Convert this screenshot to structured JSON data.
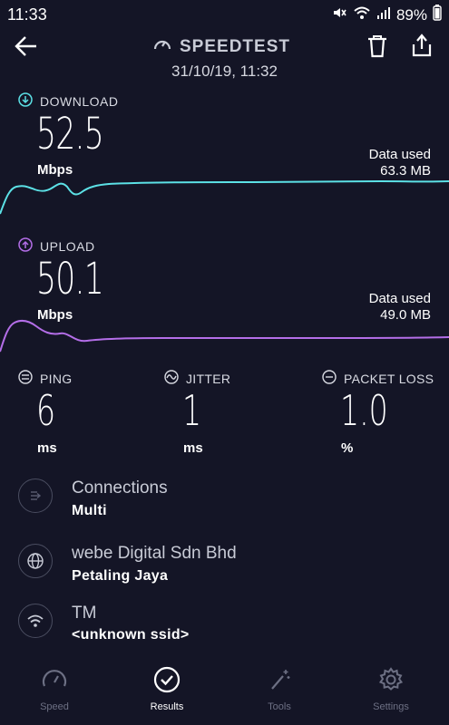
{
  "status_bar": {
    "time": "11:33",
    "battery": "89%"
  },
  "header": {
    "title": "SPEEDTEST",
    "datetime": "31/10/19, 11:32"
  },
  "download": {
    "label": "DOWNLOAD",
    "value": "52.5",
    "unit": "Mbps",
    "data_used_label": "Data used",
    "data_used_value": "63.3 MB",
    "color": "#5ce1e6"
  },
  "upload": {
    "label": "UPLOAD",
    "value": "50.1",
    "unit": "Mbps",
    "data_used_label": "Data used",
    "data_used_value": "49.0 MB",
    "color": "#b46ee8"
  },
  "stats": {
    "ping": {
      "label": "PING",
      "value": "6",
      "unit": "ms"
    },
    "jitter": {
      "label": "JITTER",
      "value": "1",
      "unit": "ms"
    },
    "packet_loss": {
      "label": "PACKET LOSS",
      "value": "1.0",
      "unit": "%"
    }
  },
  "info": {
    "connections": {
      "title": "Connections",
      "value": "Multi"
    },
    "provider": {
      "title": "webe Digital Sdn Bhd",
      "value": "Petaling Jaya"
    },
    "network": {
      "title": "TM",
      "value": "<unknown ssid>"
    }
  },
  "nav": {
    "speed": "Speed",
    "results": "Results",
    "tools": "Tools",
    "settings": "Settings",
    "active": "results"
  }
}
